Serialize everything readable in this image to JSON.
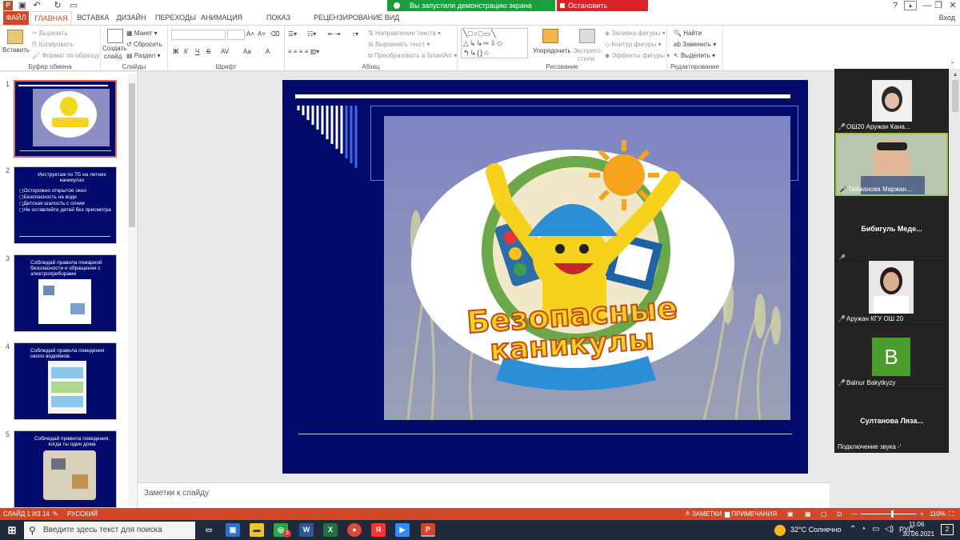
{
  "titlebar": {
    "share_status": "Вы запустили демонстрацию экрана",
    "stop_share": "Остановить демонстрацию",
    "help": "?",
    "minimize": "—",
    "maximize": "❐",
    "close": "✕"
  },
  "tabs": [
    "ФАЙЛ",
    "ГЛАВНАЯ",
    "ВСТАВКА",
    "ДИЗАЙН",
    "ПЕРЕХОДЫ",
    "АНИМАЦИЯ",
    "ПОКАЗ СЛАЙДОВ",
    "РЕЦЕНЗИРОВАНИЕ",
    "ВИД"
  ],
  "signin": "Вход",
  "ribbon": {
    "clipboard": {
      "label": "Буфер обмена",
      "paste": "Вставить",
      "cut": "Вырезать",
      "copy": "Копировать",
      "format": "Формат по образцу"
    },
    "slides": {
      "label": "Слайды",
      "create": "Создать",
      "create2": "слайд",
      "layout": "Макет",
      "reset": "Сбросить",
      "section": "Раздел"
    },
    "font": {
      "label": "Шрифт",
      "bold": "Ж",
      "italic": "К",
      "underline": "Ч",
      "strike": "S",
      "spacing": "AV",
      "case": "Aa",
      "color": "A"
    },
    "paragraph": {
      "label": "Абзац",
      "text_dir": "Направление текста",
      "align_text": "Выровнять текст",
      "smartart": "Преобразовать в SmartArt"
    },
    "drawing": {
      "label": "Рисование",
      "arrange": "Упорядочить",
      "quick1": "Экспресс-",
      "quick2": "стили",
      "fill": "Заливка фигуры",
      "outline": "Контур фигуры",
      "effects": "Эффекты фигуры"
    },
    "editing": {
      "label": "Редактирование",
      "find": "Найти",
      "replace": "Заменить",
      "select": "Выделить"
    }
  },
  "thumbnails": [
    {
      "num": "1",
      "title": "",
      "bullets": []
    },
    {
      "num": "2",
      "title": "Инструктаж по ТБ на летних каникулах",
      "bullets": [
        "Осторожно открытое окно",
        "Безопасность на воде",
        "Детская шалость с огнем",
        "Не оставляйте детей без присмотра"
      ]
    },
    {
      "num": "3",
      "title": "Соблюдай правила пожарной безопасности и обращения с электроприборами",
      "bullets": []
    },
    {
      "num": "4",
      "title": "Соблюдай правила поведения около водоёмов.",
      "bullets": []
    },
    {
      "num": "5",
      "title": "Соблюдай правила поведения, когда ты один дома",
      "bullets": []
    }
  ],
  "slide": {
    "logo_line1": "Безопасные",
    "logo_line2": "каникулы"
  },
  "notes_placeholder": "Заметки к слайду",
  "participants": [
    {
      "name": "ОШ20 Аружан Кана...",
      "type": "photo",
      "color": "#2a2a2a"
    },
    {
      "name": "Тайжанова Маржан...",
      "type": "photo",
      "color": "#8a9a7a",
      "active": true
    },
    {
      "name": "Бибигуль  Меде...",
      "type": "name"
    },
    {
      "name": "Аружан КГУ ОШ 20",
      "type": "photo",
      "color": "#d8d8d8"
    },
    {
      "name": "Balnur Bakytkyzy",
      "type": "avatar",
      "letter": "B",
      "color": "#4a9c2b"
    },
    {
      "name": "Султанова  Ляза...",
      "type": "name"
    }
  ],
  "audio_status": "Подключение звука -'",
  "statusbar": {
    "slide_info": "СЛАЙД 1 ИЗ 14",
    "lang": "РУССКИЙ",
    "notes": "ЗАМЕТКИ",
    "comments": "ПРИМЕЧАНИЯ",
    "zoom": "110%"
  },
  "taskbar": {
    "search": "Введите здесь текст для поиска",
    "weather": "32°C  Солнечно",
    "lang": "РУС",
    "time": "11:06",
    "date": "30.06.2021",
    "notif": "2",
    "badge": "3"
  }
}
